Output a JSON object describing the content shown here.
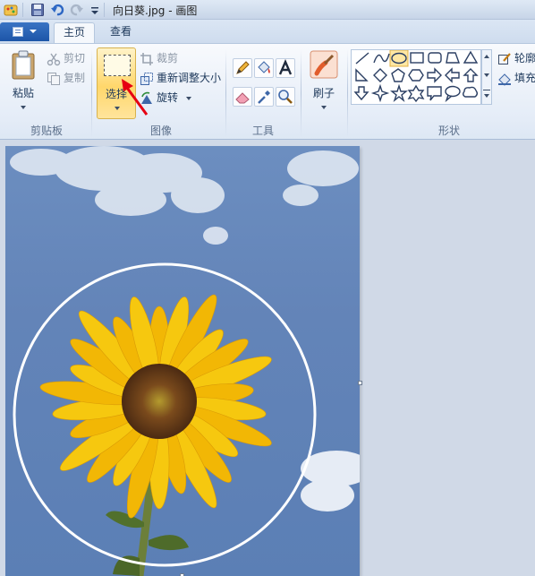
{
  "window": {
    "title": "向日葵.jpg - 画图"
  },
  "tabs": [
    {
      "label": "主页",
      "active": true
    },
    {
      "label": "查看",
      "active": false
    }
  ],
  "ribbon": {
    "clipboard": {
      "group_label": "剪贴板",
      "paste_label": "粘贴",
      "cut_label": "剪切",
      "copy_label": "复制"
    },
    "image": {
      "group_label": "图像",
      "select_label": "选择",
      "crop_label": "裁剪",
      "resize_label": "重新调整大小",
      "rotate_label": "旋转"
    },
    "tools": {
      "group_label": "工具",
      "items": [
        "pencil-icon",
        "fill-bucket-icon",
        "text-icon",
        "eraser-icon",
        "color-picker-icon",
        "magnifier-icon"
      ]
    },
    "brushes": {
      "label": "刷子"
    },
    "shapes": {
      "group_label": "形状",
      "outline_label": "轮廓",
      "fill_label": "填充"
    }
  },
  "colors": {
    "accent": "#1c55a8",
    "select_highlight": "#ffd76b",
    "annotation_arrow": "#e60012",
    "sky": "#6384b8",
    "petal": "#f6c80f"
  }
}
